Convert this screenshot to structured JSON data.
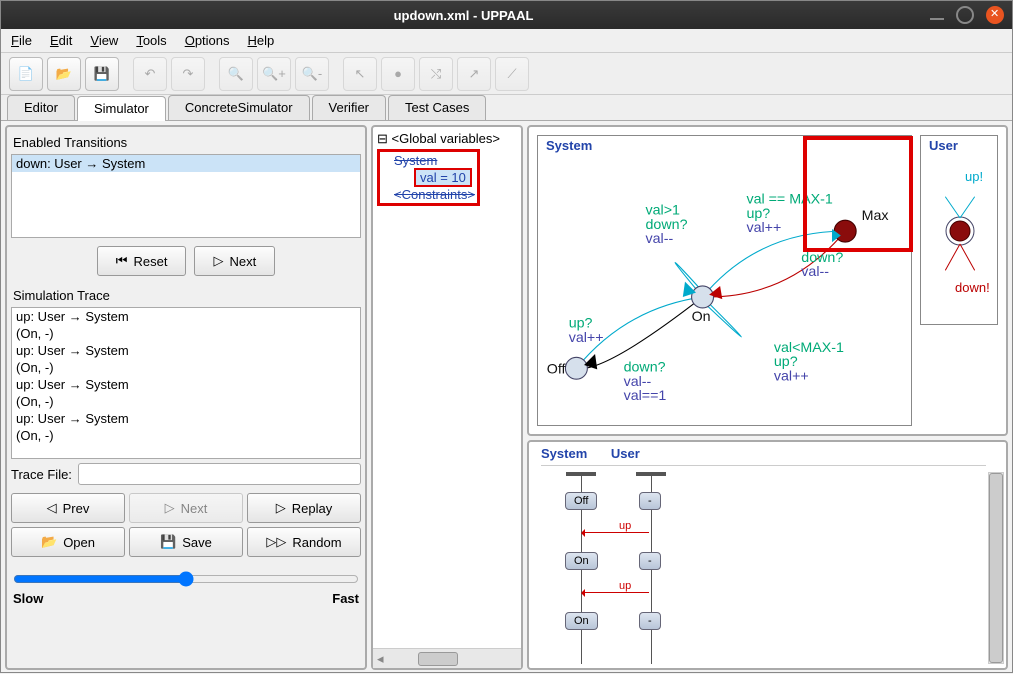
{
  "window": {
    "title": "updown.xml - UPPAAL"
  },
  "menu": {
    "file": "File",
    "edit": "Edit",
    "view": "View",
    "tools": "Tools",
    "options": "Options",
    "help": "Help"
  },
  "tabs": {
    "editor": "Editor",
    "simulator": "Simulator",
    "concrete": "ConcreteSimulator",
    "verifier": "Verifier",
    "tests": "Test Cases",
    "active": "Simulator"
  },
  "enabled": {
    "label": "Enabled Transitions",
    "items": [
      "down: User → System"
    ]
  },
  "buttons": {
    "reset": "Reset",
    "next": "Next",
    "prev": "Prev",
    "next2": "Next",
    "replay": "Replay",
    "open": "Open",
    "save": "Save",
    "random": "Random"
  },
  "trace": {
    "label": "Simulation Trace",
    "items": [
      "up: User → System",
      "(On, -)",
      "up: User → System",
      "(On, -)",
      "up: User → System",
      "(On, -)",
      "up: User → System",
      "(On, -)"
    ],
    "file_label": "Trace File:"
  },
  "speed": {
    "slow": "Slow",
    "fast": "Fast"
  },
  "tree": {
    "root": "<Global variables>",
    "system": "System",
    "val": "val = 10",
    "constraints": "<Constraints>"
  },
  "system_panel": {
    "title": "System",
    "labels": {
      "valgt1": "val>1",
      "down_q": "down?",
      "valmm": "val--",
      "valeqmax": "val == MAX-1",
      "up_q": "up?",
      "valpp": "val++",
      "down_q2": "down?",
      "valmm2": "val--",
      "up_q2": "up?",
      "valpp2": "val++",
      "down_q3": "down?",
      "valmm3": "val--",
      "valeq1": "val==1",
      "valltmax": "val<MAX-1",
      "up_q3": "up?",
      "valpp3": "val++",
      "on": "On",
      "off": "Off",
      "max": "Max"
    }
  },
  "user_panel": {
    "title": "User",
    "up": "up!",
    "down": "down!"
  },
  "msc": {
    "head_system": "System",
    "head_user": "User",
    "states_system": [
      "Off",
      "On",
      "On"
    ],
    "states_user": [
      "-",
      "-",
      "-"
    ],
    "messages": [
      "up",
      "up"
    ]
  }
}
